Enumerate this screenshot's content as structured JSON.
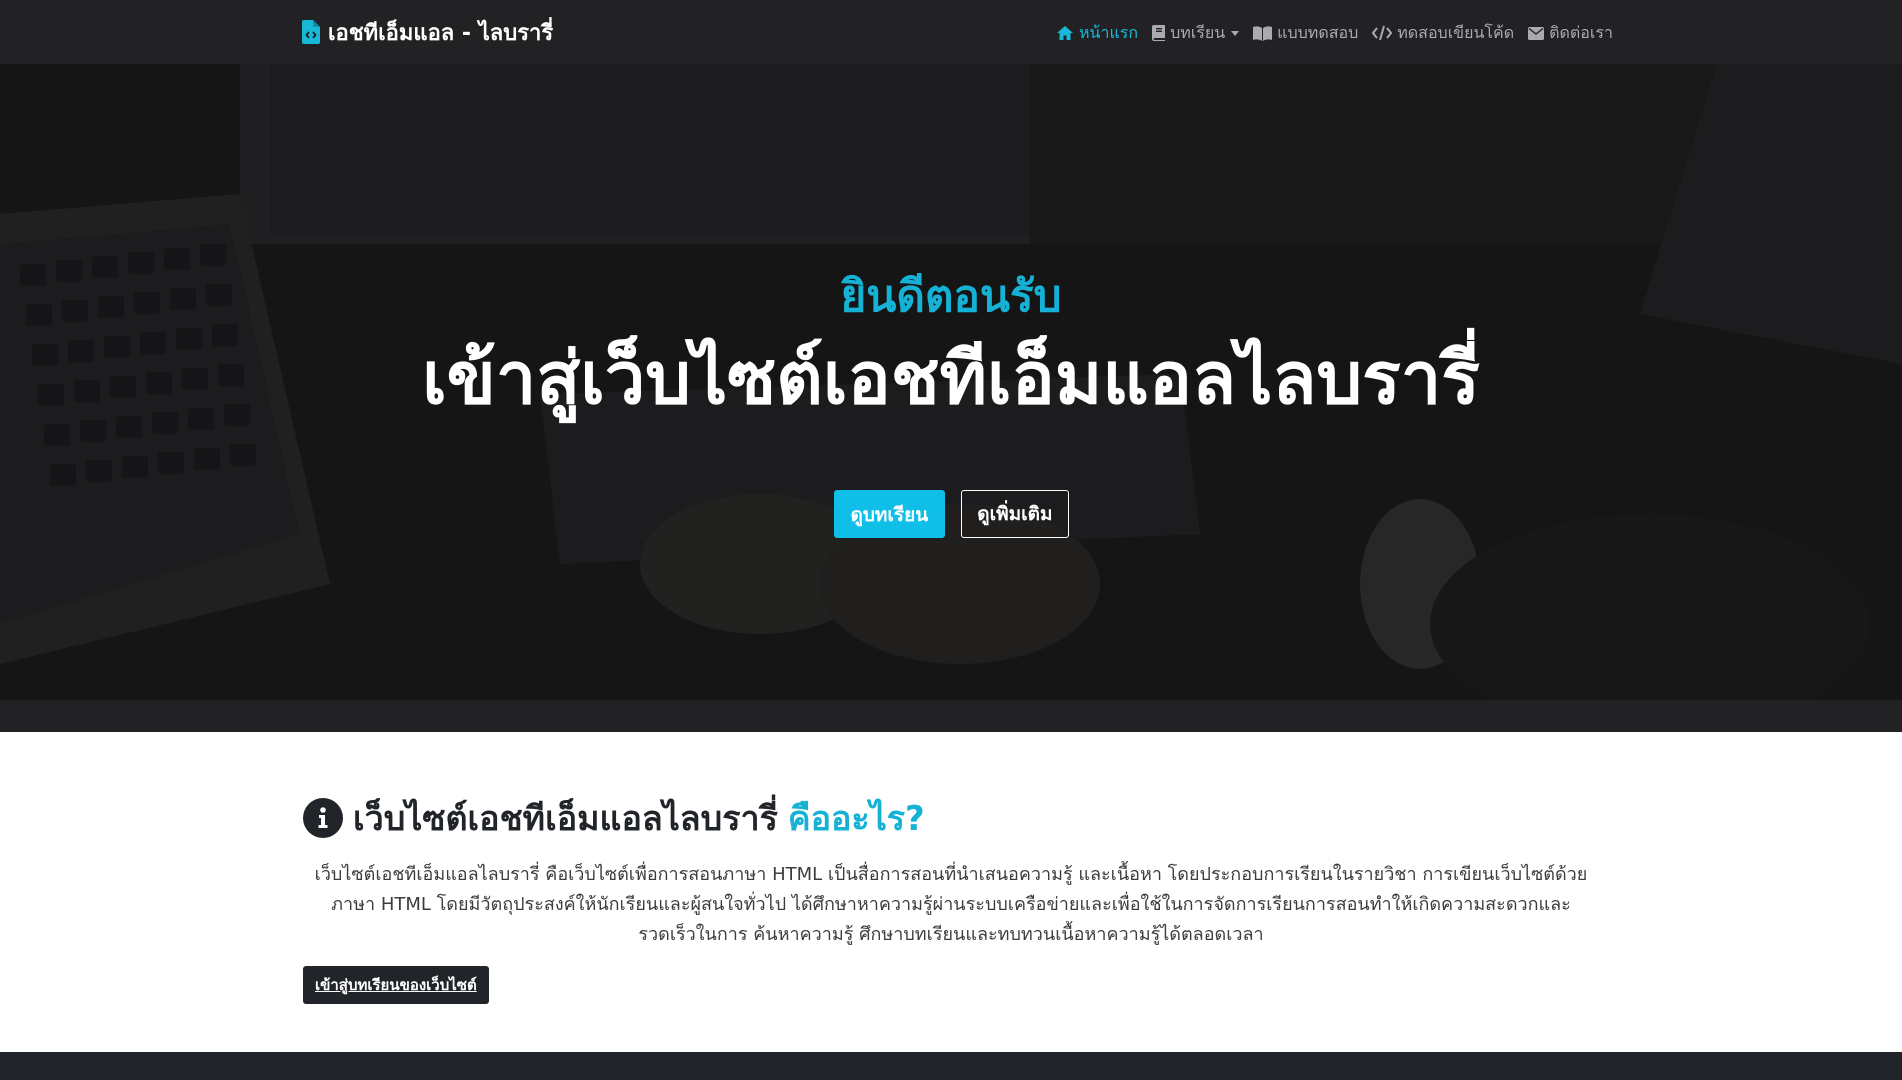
{
  "navbar": {
    "brand": "เอชทีเอ็มแอล - ไลบรารี่",
    "items": [
      {
        "label": "หน้าแรก",
        "icon": "home-icon",
        "active": true
      },
      {
        "label": "บทเรียน",
        "icon": "book-icon",
        "dropdown": true
      },
      {
        "label": "แบบทดสอบ",
        "icon": "open-book-icon"
      },
      {
        "label": "ทดสอบเขียนโค้ด",
        "icon": "code-icon"
      },
      {
        "label": "ติดต่อเรา",
        "icon": "envelope-icon"
      }
    ]
  },
  "hero": {
    "subtitle": "ยินดีตอนรับ",
    "title": "เข้าสู่เว็บไซต์เอชทีเอ็มแอลไลบรารี่",
    "primary_button": "ดูบทเรียน",
    "secondary_button": "ดูเพิ่มเติม"
  },
  "about": {
    "heading": "เว็บไซต์เอชทีเอ็มแอลไลบรารี่",
    "heading_accent": "คืออะไร?",
    "text": "เว็บไซต์เอชทีเอ็มแอลไลบรารี่ คือเว็บไซต์เพื่อการสอนภาษา HTML เป็นสื่อการสอนที่นำเสนอความรู้ และเนื้อหา โดยประกอบการเรียนในรายวิชา การเขียนเว็บไซต์ด้วยภาษา HTML โดยมีวัตถุประสงค์ให้นักเรียนและผู้สนใจทั่วไป ได้ศึกษาหาความรู้ผ่านระบบเครือข่ายและเพื่อใช้ในการจัดการเรียนการสอนทำให้เกิดความสะดวกและรวดเร็วในการ ค้นหาความรู้ ศึกษาบทเรียนและทบทวนเนื้อหาความรู้ได้ตลอดเวลา",
    "button": "เข้าสู่บทเรียนของเว็บไซต์"
  },
  "colors": {
    "accent": "#15b2d6",
    "navbar_bg": "#222224",
    "button_primary": "#0fbfe7",
    "dark": "#212529"
  }
}
